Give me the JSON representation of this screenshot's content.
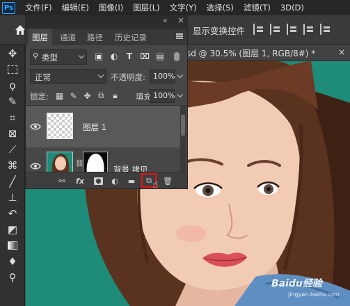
{
  "app": {
    "logo": "Ps"
  },
  "menu": [
    "文件(F)",
    "编辑(E)",
    "图像(I)",
    "图层(L)",
    "文字(Y)",
    "选择(S)",
    "滤镜(T)",
    "3D(D)"
  ],
  "options_bar": {
    "home_icon": "home-icon",
    "transform_controls_label": "显示变换控件"
  },
  "document_tab": {
    "title": "sd @ 30.5% (图层 1, RGB/8#) *",
    "close": "×"
  },
  "layers_panel": {
    "collapse": "«",
    "close": "×",
    "tabs": [
      "图层",
      "通道",
      "路径",
      "历史记录"
    ],
    "active_tab": "图层",
    "filter": {
      "label": "类型",
      "icons": [
        "image-filter-icon",
        "adjustment-filter-icon",
        "type-filter-icon",
        "shape-filter-icon",
        "smart-object-filter-icon"
      ]
    },
    "blend_mode": "正常",
    "opacity_label": "不透明度:",
    "opacity_value": "100%",
    "lock_label": "锁定:",
    "fill_label": "填充:",
    "fill_value": "100%",
    "layers": [
      {
        "name": "图层 1",
        "selected": true,
        "visible": true
      },
      {
        "name": "背景 拷贝",
        "selected": false,
        "visible": true
      }
    ],
    "bottom_icons": [
      "link-layers-icon",
      "fx-icon",
      "add-mask-icon",
      "adjustment-layer-icon",
      "group-folder-icon",
      "new-layer-icon",
      "trash-icon"
    ],
    "fx_label": "fx",
    "highlight_color": "#e01515"
  },
  "tools": [
    "move-tool-icon",
    "marquee-tool-icon",
    "lasso-tool-icon",
    "quick-select-tool-icon",
    "crop-tool-icon",
    "frame-tool-icon",
    "eyedropper-tool-icon",
    "healing-brush-tool-icon",
    "brush-tool-icon",
    "clone-stamp-tool-icon",
    "history-brush-tool-icon",
    "eraser-tool-icon",
    "gradient-tool-icon",
    "blur-tool-icon",
    "dodge-tool-icon"
  ],
  "canvas": {
    "background_color": "#1e8c79"
  },
  "watermark": {
    "text": "Baidu经验",
    "sub": "jingyan.baidu.com"
  }
}
